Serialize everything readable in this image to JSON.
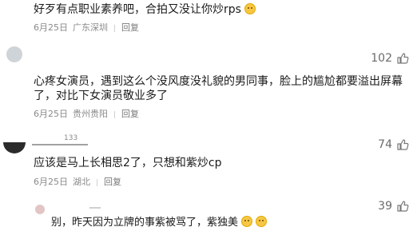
{
  "comments": [
    {
      "text": "好歹有点职业素养吧，合拍又没让你炒rps",
      "date": "6月25日",
      "location": "广东深圳",
      "reply_label": "回复"
    },
    {
      "likes": "102",
      "text_line1": "心疼女演员，遇到这么个没风度没礼貌的男同事，脸上的尴尬都要溢出屏幕",
      "text_line2": "了，对比下女演员敬业多了",
      "date": "6月25日",
      "location": "贵州贵阳",
      "reply_label": "回复"
    },
    {
      "likes": "74",
      "sub_count": "133",
      "text": "应该是马上长相思2了，只想和紫炒cp",
      "date": "6月25日",
      "location": "湖北",
      "reply_label": "回复"
    },
    {
      "likes": "39",
      "text": "别，昨天因为立牌的事紫被骂了，紫独美"
    }
  ],
  "icons": {
    "like": "thumbs-up-icon",
    "emoji": "face-emoji-icon"
  }
}
